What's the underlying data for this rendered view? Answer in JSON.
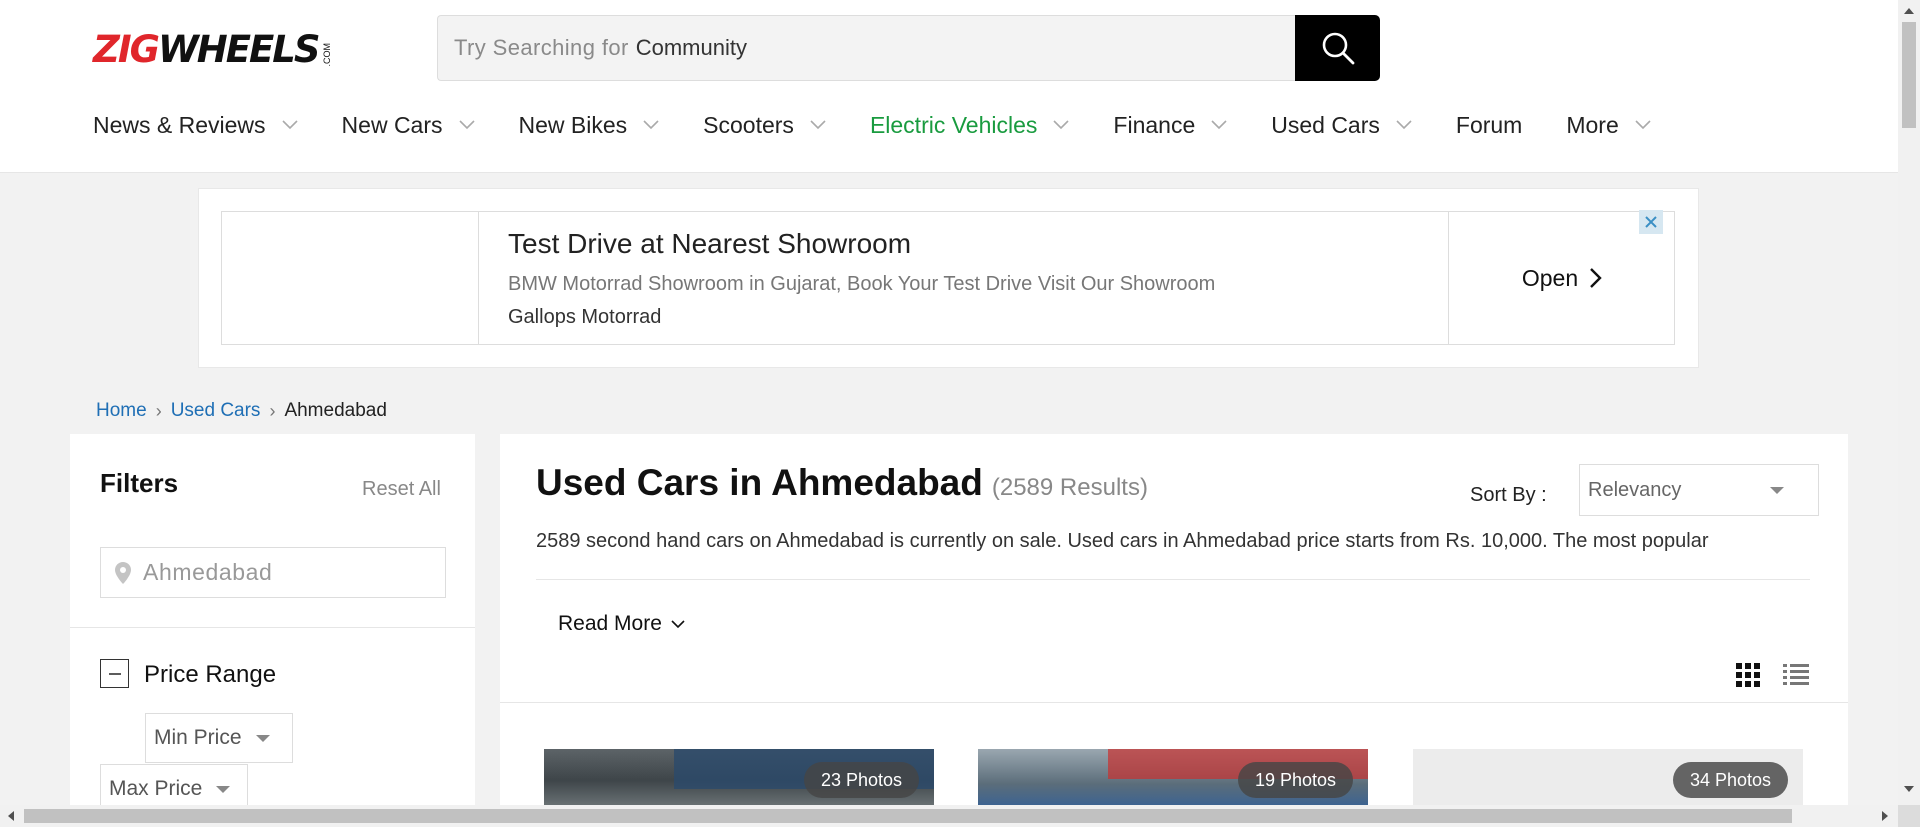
{
  "header": {
    "logo": {
      "part1": "ZIG",
      "part2": "WHEELS",
      "suffix": ".COM"
    },
    "search": {
      "hint": "Try Searching for",
      "term": "Community"
    },
    "nav": [
      {
        "label": "News & Reviews",
        "has_dropdown": true
      },
      {
        "label": "New Cars",
        "has_dropdown": true
      },
      {
        "label": "New Bikes",
        "has_dropdown": true
      },
      {
        "label": "Scooters",
        "has_dropdown": true
      },
      {
        "label": "Electric Vehicles",
        "has_dropdown": true,
        "color": "#199b3f"
      },
      {
        "label": "Finance",
        "has_dropdown": true
      },
      {
        "label": "Used Cars",
        "has_dropdown": true
      },
      {
        "label": "Forum",
        "has_dropdown": false
      },
      {
        "label": "More",
        "has_dropdown": true
      }
    ]
  },
  "ad": {
    "title": "Test Drive at Nearest Showroom",
    "description": "BMW Motorrad Showroom in Gujarat, Book Your Test Drive Visit Our Showroom",
    "brand": "Gallops Motorrad",
    "cta": "Open"
  },
  "breadcrumb": {
    "items": [
      "Home",
      "Used Cars"
    ],
    "current": "Ahmedabad"
  },
  "filters": {
    "title": "Filters",
    "reset_label": "Reset All",
    "location_value": "Ahmedabad",
    "price_range_label": "Price Range",
    "min_price": "Min Price",
    "max_price": "Max Price"
  },
  "main": {
    "title": "Used Cars in Ahmedabad",
    "results": "(2589 Results)",
    "sort_label": "Sort By :",
    "sort_value": "Relevancy",
    "description": "2589 second hand cars on Ahmedabad is currently on sale. Used cars in Ahmedabad price starts from Rs. 10,000. The most popular",
    "read_more": "Read More",
    "cards": [
      {
        "photos": "23 Photos"
      },
      {
        "photos": "19 Photos"
      },
      {
        "photos": "34 Photos"
      }
    ]
  },
  "colors": {
    "brand_red": "#e0262b",
    "link_blue": "#1f6fb5",
    "ev_green": "#199b3f"
  }
}
